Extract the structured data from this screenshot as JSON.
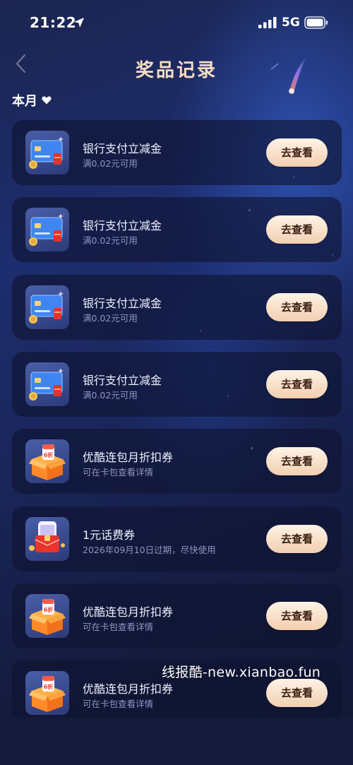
{
  "status_bar": {
    "time": "21:22",
    "network": "5G"
  },
  "header": {
    "title": "奖品记录"
  },
  "filter": {
    "month_label": "本月"
  },
  "prizes": [
    {
      "name": "银行支付立减金",
      "detail": "满0.02元可用",
      "button": "去查看",
      "icon": "bank-card-icon"
    },
    {
      "name": "银行支付立减金",
      "detail": "满0.02元可用",
      "button": "去查看",
      "icon": "bank-card-icon"
    },
    {
      "name": "银行支付立减金",
      "detail": "满0.02元可用",
      "button": "去查看",
      "icon": "bank-card-icon"
    },
    {
      "name": "银行支付立减金",
      "detail": "满0.02元可用",
      "button": "去查看",
      "icon": "bank-card-icon"
    },
    {
      "name": "优酷连包月折扣券",
      "detail": "可在卡包查看详情",
      "button": "去查看",
      "icon": "gift-box-icon",
      "badge": "6折"
    },
    {
      "name": "1元话费券",
      "detail": "2026年09月10日过期，尽快使用",
      "button": "去查看",
      "icon": "phone-coupon-icon"
    },
    {
      "name": "优酷连包月折扣券",
      "detail": "可在卡包查看详情",
      "button": "去查看",
      "icon": "gift-box-icon",
      "badge": "6折"
    },
    {
      "name": "优酷连包月折扣券",
      "detail": "可在卡包查看详情",
      "button": "去查看",
      "icon": "gift-box-icon",
      "badge": "6折"
    }
  ],
  "watermark": "线报酷-new.xianbao.fun",
  "colors": {
    "title": "#f6dcc4",
    "button_text": "#3a1e10",
    "card_bg": "rgba(14,20,48,0.62)"
  }
}
